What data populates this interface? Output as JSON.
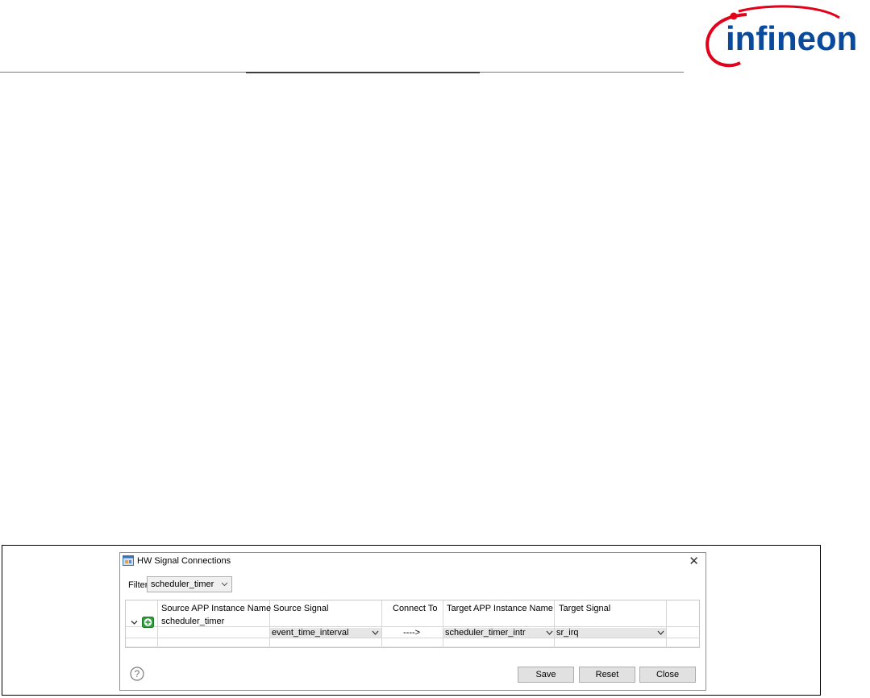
{
  "logo": {
    "text": "infineon",
    "color": "#0a4a9c",
    "swoosh_color": "#e2001a"
  },
  "dialog": {
    "title": "HW Signal Connections",
    "close_icon": "close-icon",
    "filter": {
      "label": "Filter",
      "value": "scheduler_timer"
    },
    "table": {
      "columns": [
        "Source APP Instance Name",
        "Source Signal",
        "Connect To",
        "Target APP Instance Name",
        "Target Signal"
      ],
      "group": {
        "name": "scheduler_timer",
        "expand_icon": "chevron-down-icon",
        "add_icon": "add-icon"
      },
      "rows": [
        {
          "source_signal": "event_time_interval",
          "connect_to": "---->",
          "target_app": "scheduler_timer_intr",
          "target_signal": "sr_irq"
        }
      ]
    },
    "help_icon": "help-icon",
    "buttons": {
      "save": "Save",
      "reset": "Reset",
      "close": "Close"
    }
  }
}
